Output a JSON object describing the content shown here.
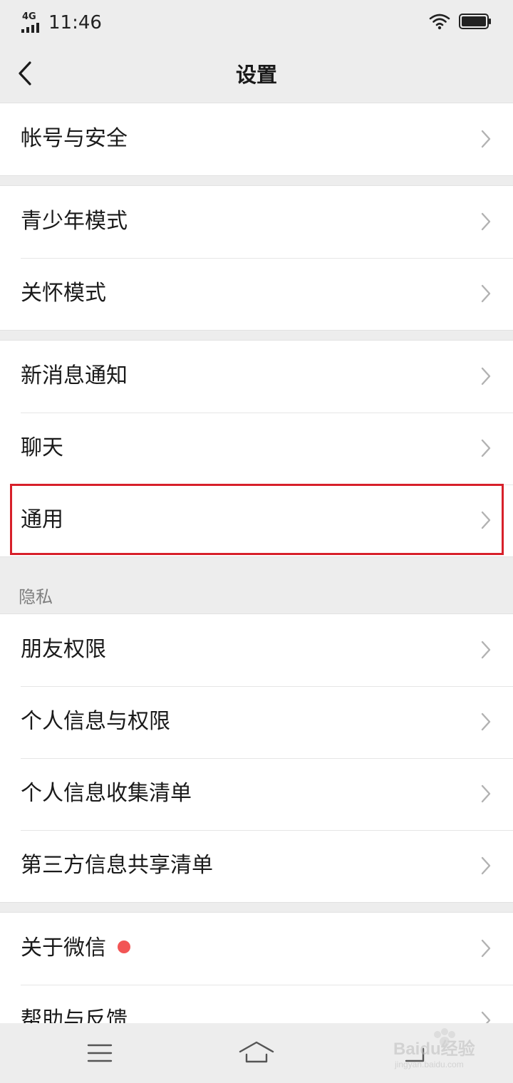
{
  "status": {
    "network_label": "4G",
    "time": "11:46"
  },
  "header": {
    "title": "设置"
  },
  "groups": [
    {
      "items": [
        {
          "label": "帐号与安全"
        }
      ]
    },
    {
      "items": [
        {
          "label": "青少年模式"
        },
        {
          "label": "关怀模式"
        }
      ]
    },
    {
      "items": [
        {
          "label": "新消息通知"
        },
        {
          "label": "聊天"
        },
        {
          "label": "通用",
          "highlighted": true
        }
      ]
    },
    {
      "section_title": "隐私",
      "items": [
        {
          "label": "朋友权限"
        },
        {
          "label": "个人信息与权限"
        },
        {
          "label": "个人信息收集清单"
        },
        {
          "label": "第三方信息共享清单"
        }
      ]
    },
    {
      "items": [
        {
          "label": "关于微信",
          "badge": "red-dot"
        },
        {
          "label": "帮助与反馈"
        }
      ]
    }
  ],
  "system_nav": {
    "icons": [
      "menu-icon",
      "home-icon",
      "back-icon"
    ]
  },
  "watermark": {
    "text": "Baidu经验",
    "url_text": "jingyan.baidu.com"
  },
  "colors": {
    "background": "#ededed",
    "card": "#ffffff",
    "highlight_border": "#d7202a",
    "badge": "#f25555"
  }
}
